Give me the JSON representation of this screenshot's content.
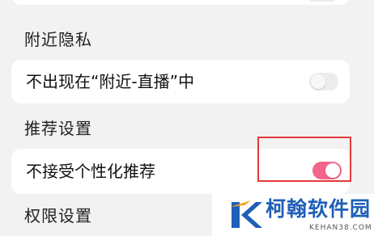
{
  "partial_row": {
    "label": "",
    "toggle_on": false
  },
  "sections": {
    "nearby_privacy": "附近隐私",
    "recommend_settings": "推荐设置",
    "permission_settings": "权限设置"
  },
  "rows": {
    "nearby_live": {
      "label": "不出现在“附近-直播”中",
      "toggle_on": false
    },
    "personalized": {
      "label": "不接受个性化推荐",
      "toggle_on": true
    }
  },
  "colors": {
    "background": "#f2f2f3",
    "card": "#ffffff",
    "toggle_on": "#f3668b",
    "toggle_off": "#ececec",
    "highlight": "#e23a3a",
    "watermark_text": "#1f5fb8"
  },
  "watermark": {
    "name": "柯翰软件园",
    "domain": "KEHAN38.COM"
  }
}
